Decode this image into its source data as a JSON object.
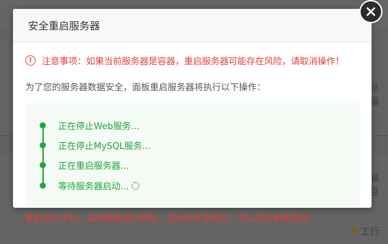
{
  "dialog": {
    "title": "安全重启服务器",
    "warning": "注意事项：如果当前服务器是容器，重启服务器可能存在风险，请取消操作！",
    "intro": "为了您的服务器数据安全，面板重启服务器将执行以下操作：",
    "steps": [
      "正在停止Web服务...",
      "正在停止MySQL服务...",
      "正在重启服务器...",
      "等待服务器启动..."
    ],
    "footer_note": "重启进行中时，请勿随意进行刷新，若长时间未响应，可以进行刷新尝试。"
  },
  "background": {
    "right_text_1": "站编",
    "right_text_2": "磁盘",
    "status_label": "工行"
  },
  "colors": {
    "accent_green": "#20a53a",
    "warning_red": "#e53c3c",
    "status_dot": "#c79a2c"
  }
}
